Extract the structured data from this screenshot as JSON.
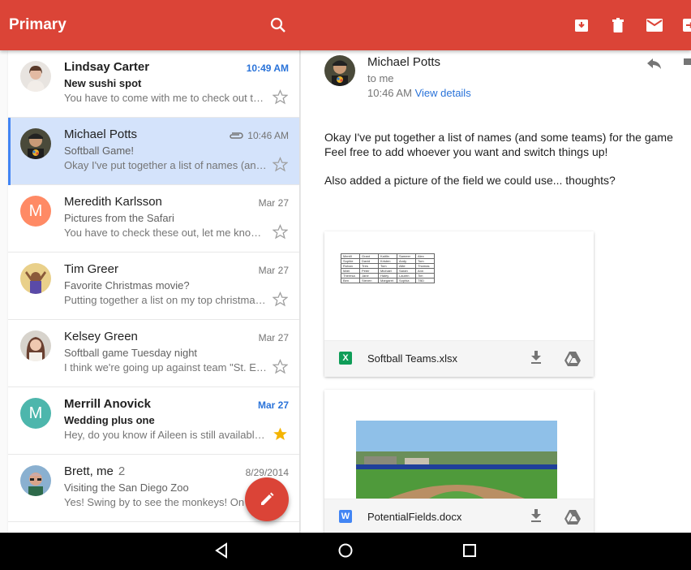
{
  "header": {
    "title": "Primary"
  },
  "toolbar": {
    "icons": [
      "search-icon",
      "archive-icon",
      "delete-icon",
      "mark-unread-icon",
      "move-icon"
    ]
  },
  "colors": {
    "brand_red": "#db4437",
    "selected_row": "#d4e3fb",
    "link_blue": "#2a73d9",
    "star_yellow": "#f4b400"
  },
  "emails": [
    {
      "sender": "Lindsay Carter",
      "count": "",
      "date": "10:49 AM",
      "subject": "New sushi spot",
      "snippet": "You have to come with me to check out thi…",
      "unread": true,
      "starred": false,
      "attachment": false,
      "avatar": "photo",
      "avatar_letter": "",
      "avatar_color": "#c9a998"
    },
    {
      "sender": "Michael Potts",
      "count": "",
      "date": "10:46 AM",
      "subject": "Softball Game!",
      "snippet": "Okay I've put together a list of names (and…",
      "unread": false,
      "starred": false,
      "attachment": true,
      "selected": true,
      "avatar": "photo",
      "avatar_letter": "",
      "avatar_color": "#3a3a3a"
    },
    {
      "sender": "Meredith Karlsson",
      "count": "",
      "date": "Mar 27",
      "subject": "Pictures from the Safari",
      "snippet": "You have to check these out, let me know …",
      "unread": false,
      "starred": false,
      "attachment": false,
      "avatar": "letter",
      "avatar_letter": "M",
      "avatar_color": "#ff8a65"
    },
    {
      "sender": "Tim Greer",
      "count": "",
      "date": "Mar 27",
      "subject": "Favorite Christmas movie?",
      "snippet": "Putting together a list on my top christmas…",
      "unread": false,
      "starred": false,
      "attachment": false,
      "avatar": "photo",
      "avatar_letter": "",
      "avatar_color": "#d7a15c"
    },
    {
      "sender": "Kelsey Green",
      "count": "",
      "date": "Mar 27",
      "subject": "Softball game Tuesday night",
      "snippet": "I think we're going up against team \"St. El…",
      "unread": false,
      "starred": false,
      "attachment": false,
      "avatar": "photo",
      "avatar_letter": "",
      "avatar_color": "#a0776a"
    },
    {
      "sender": "Merrill Anovick",
      "count": "",
      "date": "Mar 27",
      "subject": "Wedding plus one",
      "snippet": "Hey, do you know if Aileen is still available…",
      "unread": true,
      "starred": true,
      "attachment": false,
      "avatar": "letter",
      "avatar_letter": "M",
      "avatar_color": "#4db6ac"
    },
    {
      "sender": "Brett, me",
      "count": "2",
      "date": "8/29/2014",
      "subject": "Visiting the San Diego Zoo",
      "snippet": "Yes! Swing by to see the monkeys! On F…",
      "unread": false,
      "starred": false,
      "attachment": false,
      "avatar": "photo",
      "avatar_letter": "",
      "avatar_color": "#b58e74"
    }
  ],
  "detail": {
    "from": "Michael Potts",
    "to": "to me",
    "time": "10:46 AM",
    "view_details": "View details",
    "body": [
      "Okay I've put together a list of names (and some teams) for the game",
      "Feel free to add whoever you want and switch things up!",
      "Also added a picture of the field we could use... thoughts?"
    ],
    "attachments": [
      {
        "name": "Softball Teams.xlsx",
        "type": "xlsx",
        "icon_letter": "X",
        "icon_color": "#0f9d58"
      },
      {
        "name": "PotentialFields.docx",
        "type": "docx",
        "icon_letter": "W",
        "icon_color": "#4285f4"
      }
    ],
    "sheet_rows": [
      [
        "Merrill",
        "Grant",
        "Kaitlin",
        "Sameer",
        "Alex"
      ],
      [
        "Sophie",
        "David",
        "Kristen",
        "Andy",
        "Tom"
      ],
      [
        "Rohan",
        "Tres",
        "Tom",
        "Allie",
        "Thomas"
      ],
      [
        "Matt",
        "Peter",
        "Michael",
        "Sarah",
        "Ann"
      ],
      [
        "Theresa",
        "Jane",
        "Haley",
        "Lauren",
        "Tim"
      ],
      [
        "Ben",
        "Steven",
        "Margaret",
        "Sophia",
        "TBD"
      ]
    ]
  },
  "navbar": {
    "icons": [
      "back-icon",
      "home-icon",
      "recents-icon"
    ]
  }
}
